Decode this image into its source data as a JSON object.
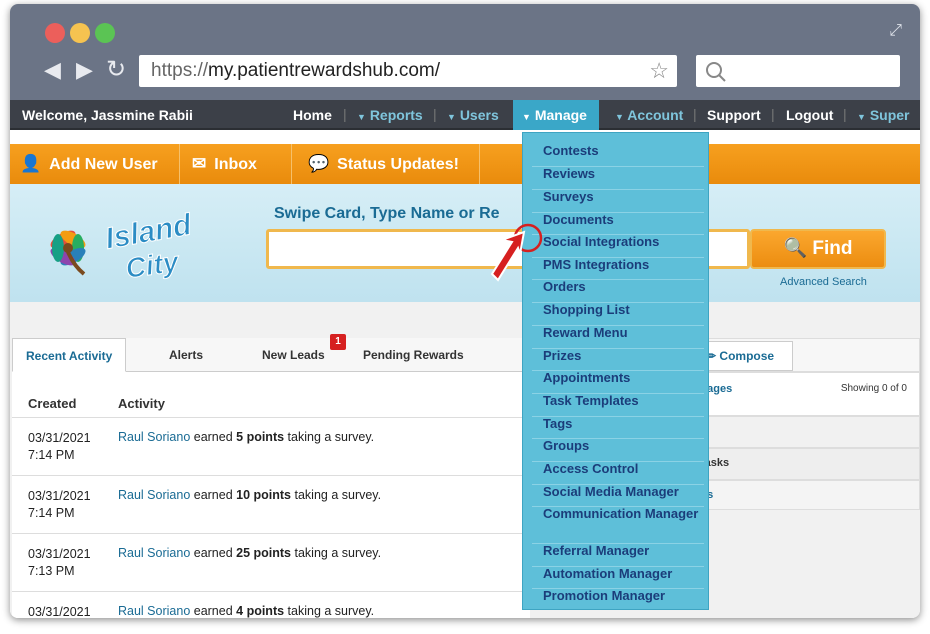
{
  "browser": {
    "url_protocol": "https://",
    "url_host": "my.patientrewardshub.com/"
  },
  "topnav": {
    "welcome": "Welcome, Jassmine Rabii",
    "home": "Home",
    "reports": "Reports",
    "users": "Users",
    "manage": "Manage",
    "account": "Account",
    "support": "Support",
    "logout": "Logout",
    "super": "Super"
  },
  "actionbar": {
    "add_user": "Add New User",
    "inbox": "Inbox",
    "status": "Status Updates!"
  },
  "header": {
    "logo_line1": "Island",
    "logo_line2": "City",
    "swipe": "Swipe Card, Type Name or Re",
    "find": "Find",
    "advanced": "Advanced Search"
  },
  "activity": {
    "tabs": [
      "Recent Activity",
      "Alerts",
      "New Leads",
      "Pending Rewards"
    ],
    "new_leads_badge": "1",
    "col_created": "Created",
    "col_activity": "Activity",
    "rows": [
      {
        "date": "03/31/2021",
        "time": "7:14 PM",
        "user": "Raul Soriano",
        "pre": " earned ",
        "points": "5 points",
        "post": " taking a survey."
      },
      {
        "date": "03/31/2021",
        "time": "7:14 PM",
        "user": "Raul Soriano",
        "pre": " earned ",
        "points": "10 points",
        "post": " taking a survey."
      },
      {
        "date": "03/31/2021",
        "time": "7:13 PM",
        "user": "Raul Soriano",
        "pre": " earned ",
        "points": "25 points",
        "post": " taking a survey."
      },
      {
        "date": "03/31/2021",
        "time": "",
        "user": "Raul Soriano",
        "pre": " earned ",
        "points": "4 points",
        "post": " taking a survey."
      }
    ]
  },
  "messages": {
    "compose": "Compose",
    "messages_label": "sages",
    "showing": "Showing 0 of 0",
    "tasks_label": "tasks",
    "tasks_label2": "ks"
  },
  "manage_menu": [
    "Contests",
    "Reviews",
    "Surveys",
    "Documents",
    "Social Integrations",
    "PMS Integrations",
    "Orders",
    "Shopping List",
    "Reward Menu",
    "Prizes",
    "Appointments",
    "Task Templates",
    "Tags",
    "Groups",
    "Access Control",
    "Social Media Manager",
    "Communication Manager",
    "Referral Manager",
    "Automation Manager",
    "Promotion Manager"
  ],
  "icons": {
    "back": "arrow-left-icon",
    "forward": "arrow-right-icon",
    "reload": "reload-icon",
    "star": "star-icon",
    "search": "magnifier-icon",
    "expand": "expand-icon",
    "user": "user-add-icon",
    "mail": "envelope-icon",
    "chat": "chat-icon",
    "pencil": "pencil-icon"
  },
  "colors": {
    "accent": "#3aa7c8",
    "nav": "#3c4048",
    "orange": "#f39a17",
    "menu": "#5ebfd9",
    "link": "#1a6b94"
  }
}
